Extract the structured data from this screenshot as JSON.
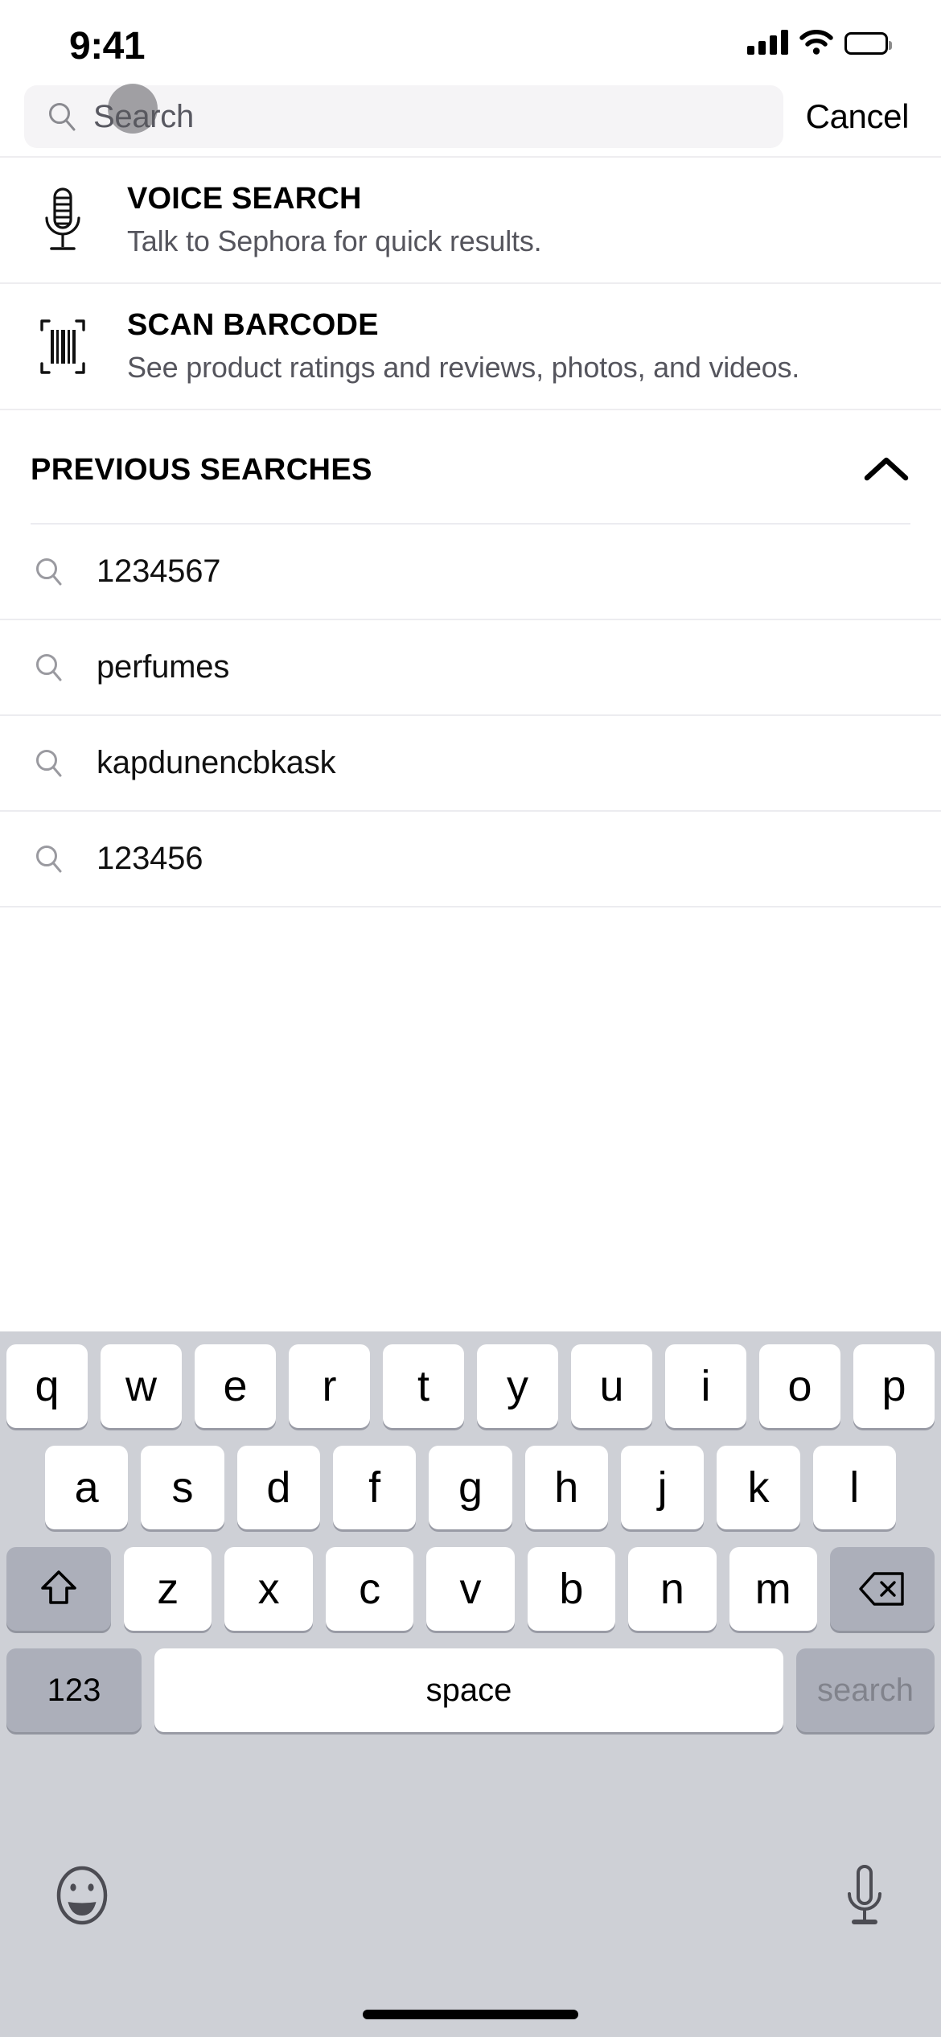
{
  "status_bar": {
    "time": "9:41",
    "signal_icon": "cellular-signal-icon",
    "wifi_icon": "wifi-icon",
    "battery_icon": "battery-full-icon"
  },
  "search": {
    "placeholder": "Search",
    "value": "",
    "icon": "search-icon",
    "cancel_label": "Cancel"
  },
  "actions": [
    {
      "id": "voice-search",
      "icon": "microphone-icon",
      "title": "VOICE SEARCH",
      "subtitle": "Talk to Sephora for quick results."
    },
    {
      "id": "scan-barcode",
      "icon": "barcode-scan-icon",
      "title": "SCAN BARCODE",
      "subtitle": "See product ratings and reviews, photos, and videos."
    }
  ],
  "previous_searches": {
    "title": "PREVIOUS SEARCHES",
    "collapse_icon": "chevron-up-icon",
    "items": [
      {
        "icon": "search-icon",
        "label": "1234567"
      },
      {
        "icon": "search-icon",
        "label": "perfumes"
      },
      {
        "icon": "search-icon",
        "label": "kapdunencbkask"
      },
      {
        "icon": "search-icon",
        "label": "123456"
      }
    ]
  },
  "keyboard": {
    "row1": [
      "q",
      "w",
      "e",
      "r",
      "t",
      "y",
      "u",
      "i",
      "o",
      "p"
    ],
    "row2": [
      "a",
      "s",
      "d",
      "f",
      "g",
      "h",
      "j",
      "k",
      "l"
    ],
    "row3": [
      "z",
      "x",
      "c",
      "v",
      "b",
      "n",
      "m"
    ],
    "shift_icon": "shift-up-arrow-icon",
    "delete_icon": "backspace-delete-icon",
    "numbers_label": "123",
    "space_label": "space",
    "return_label": "search",
    "emoji_icon": "emoji-smiley-icon",
    "dictation_icon": "microphone-icon"
  },
  "colors": {
    "search_field_bg": "#f5f4f6",
    "keyboard_bg": "#ced0d6",
    "key_bg": "#ffffff",
    "key_dark_bg": "#acafba",
    "subtitle_text": "#55555d",
    "divider": "#ececf0",
    "return_key_text": "rgba(60,60,67,0.38)"
  }
}
